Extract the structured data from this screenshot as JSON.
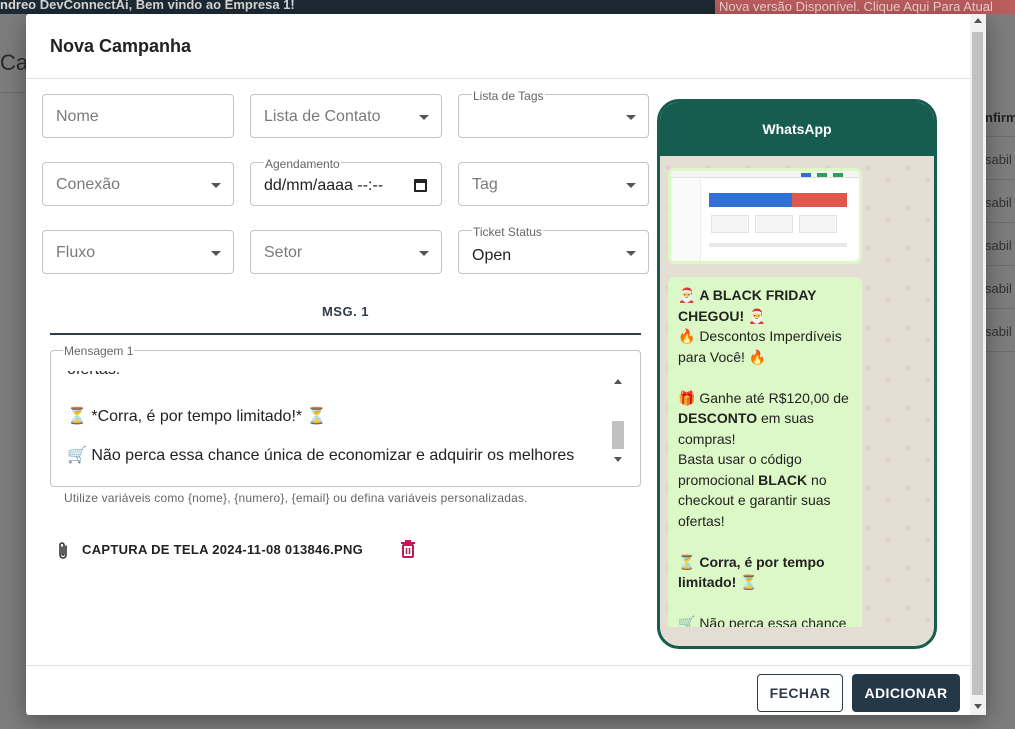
{
  "background": {
    "welcome": "ndreo DevConnectAi, Bem vindo ao Empresa 1!",
    "update_notice": "Nova versão Disponível. Clique Aqui Para Atual",
    "page_title": "Ca",
    "column_header": "nfirm",
    "row_cells": [
      "sabil",
      "sabil",
      "sabil",
      "sabil",
      "sabil"
    ]
  },
  "modal": {
    "title": "Nova Campanha",
    "fields": {
      "nome": {
        "placeholder": "Nome"
      },
      "lista_contato": {
        "placeholder": "Lista de Contato"
      },
      "lista_tags": {
        "label": "Lista de Tags",
        "value": ""
      },
      "conexao": {
        "placeholder": "Conexão"
      },
      "agendamento": {
        "label": "Agendamento",
        "value": "dd/mm/aaaa --:--"
      },
      "tag": {
        "placeholder": "Tag"
      },
      "fluxo": {
        "placeholder": "Fluxo"
      },
      "setor": {
        "placeholder": "Setor"
      },
      "ticket_status": {
        "label": "Ticket Status",
        "value": "Open"
      }
    },
    "tab": "MSG. 1",
    "message": {
      "label": "Mensagem 1",
      "lines": [
        "ofertas!",
        "⏳ *Corra, é por tempo limitado!* ⏳",
        "🛒 Não perca essa chance única de economizar e adquirir os melhores"
      ],
      "helper": "Utilize variáveis como {nome}, {numero}, {email} ou defina variáveis personalizadas."
    },
    "attachment": {
      "filename": "CAPTURA DE TELA 2024-11-08 013846.PNG"
    },
    "buttons": {
      "close": "FECHAR",
      "add": "ADICIONAR"
    }
  },
  "preview": {
    "header": "WhatsApp",
    "message": {
      "p1_icon": "🎅",
      "p1_bold": "A BLACK FRIDAY CHEGOU!",
      "p2": "🔥 Descontos Imperdíveis para Você! 🔥",
      "p3_a": "🎁 Ganhe até R$120,00 de ",
      "p3_bold": "DESCONTO",
      "p3_b": " em suas compras!",
      "p4_a": "Basta usar o código promocional ",
      "p4_bold": "BLACK",
      "p4_b": " no checkout e garantir suas ofertas!",
      "p5_bold": "Corra, é por tempo limitado!",
      "p5_icon": "⏳",
      "p6": "🛒 Não perca essa chance"
    }
  },
  "colors": {
    "primary": "#243848",
    "whatsapp_green": "#165c4f",
    "bubble": "#dcf8c6",
    "danger": "#c2185b"
  }
}
